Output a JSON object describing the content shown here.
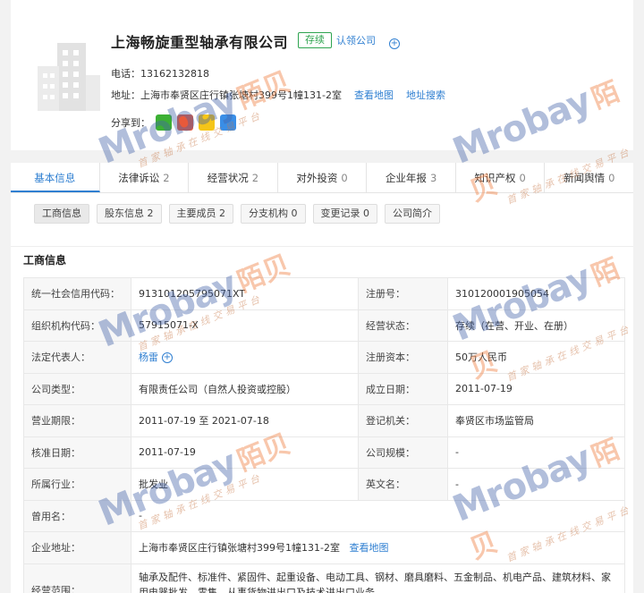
{
  "company": {
    "name": "上海畅旋重型轴承有限公司",
    "status": "存续",
    "claim_label": "认领公司",
    "phone": "电话：13162132818",
    "address": "地址：上海市奉贤区庄行镇张塘村399号1幢131-2室",
    "view_map": "查看地图",
    "address_search": "地址搜索",
    "share_label": "分享到："
  },
  "tabs": [
    {
      "label": "基本信息",
      "count": ""
    },
    {
      "label": "法律诉讼",
      "count": "2"
    },
    {
      "label": "经营状况",
      "count": "2"
    },
    {
      "label": "对外投资",
      "count": "0"
    },
    {
      "label": "企业年报",
      "count": "3"
    },
    {
      "label": "知识产权",
      "count": "0"
    },
    {
      "label": "新闻舆情",
      "count": "0"
    }
  ],
  "subtabs": [
    "工商信息",
    "股东信息 2",
    "主要成员 2",
    "分支机构 0",
    "变更记录 0",
    "公司简介"
  ],
  "section_title": "工商信息",
  "info": {
    "credit_code_label": "统一社会信用代码：",
    "credit_code": "913101205795071XT",
    "reg_no_label": "注册号：",
    "reg_no": "310120001905054",
    "org_code_label": "组织机构代码：",
    "org_code": "57915071-X",
    "biz_status_label": "经营状态：",
    "biz_status": "存续（在营、开业、在册）",
    "legal_rep_label": "法定代表人：",
    "legal_rep": "杨雷",
    "reg_capital_label": "注册资本：",
    "reg_capital": "50万人民币",
    "company_type_label": "公司类型：",
    "company_type": "有限责任公司（自然人投资或控股）",
    "founded_label": "成立日期：",
    "founded": "2011-07-19",
    "term_label": "营业期限：",
    "term": "2011-07-19 至 2021-07-18",
    "authority_label": "登记机关：",
    "authority": "奉贤区市场监管局",
    "approval_label": "核准日期：",
    "approval": "2011-07-19",
    "scale_label": "公司规模：",
    "scale": "-",
    "industry_label": "所属行业：",
    "industry": "批发业",
    "english_label": "英文名：",
    "english": "-",
    "former_label": "曾用名：",
    "former": "-",
    "addr_label": "企业地址：",
    "addr": "上海市奉贤区庄行镇张塘村399号1幢131-2室",
    "addr_map": "查看地图",
    "scope_label": "经营范围：",
    "scope": "轴承及配件、标准件、紧固件、起重设备、电动工具、钢材、磨具磨料、五金制品、机电产品、建筑材料、家用电器批发、零售，从事货物进出口及技术进出口业务。"
  },
  "watermark": {
    "brand": "Mrobay",
    "cn": "陌贝",
    "sub": "首家轴承在线交易平台"
  }
}
